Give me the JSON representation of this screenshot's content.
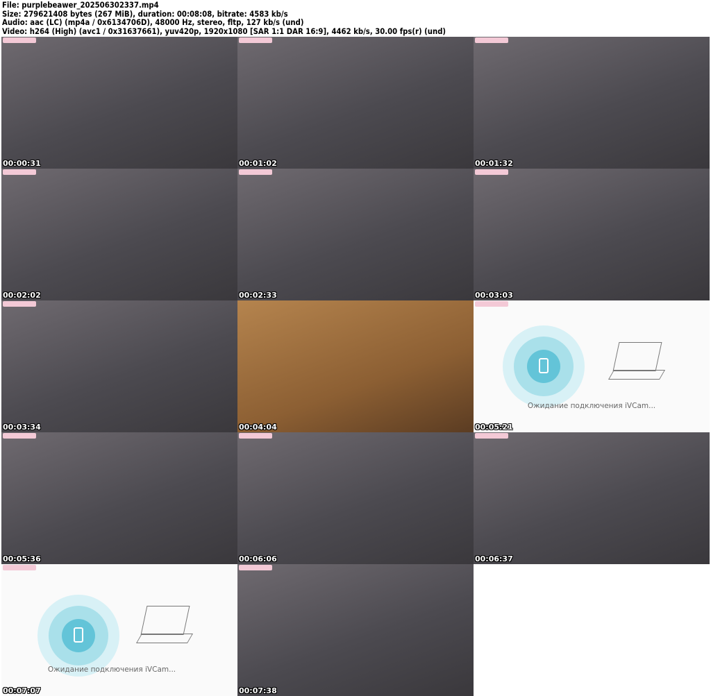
{
  "header": {
    "file": "File: purplebeawer_202506302337.mp4",
    "size": "Size: 279621408 bytes (267 MiB), duration: 00:08:08, bitrate: 4583 kb/s",
    "audio": "Audio: aac (LC) (mp4a / 0x6134706D), 48000 Hz, stereo, fltp, 127 kb/s (und)",
    "video": "Video: h264 (High) (avc1 / 0x31637661), yuv420p, 1920x1080 [SAR 1:1 DAR 16:9], 4462 kb/s, 30.00 fps(r) (und)"
  },
  "ivcam_text": "Ожидание подключения iVCam...",
  "frames": [
    {
      "time": "00:00:31"
    },
    {
      "time": "00:01:02"
    },
    {
      "time": "00:01:32"
    },
    {
      "time": "00:02:02"
    },
    {
      "time": "00:02:33"
    },
    {
      "time": "00:03:03"
    },
    {
      "time": "00:03:34"
    },
    {
      "time": "00:04:04"
    },
    {
      "time": "00:05:21"
    },
    {
      "time": "00:05:36"
    },
    {
      "time": "00:06:06"
    },
    {
      "time": "00:06:37"
    },
    {
      "time": "00:07:07"
    },
    {
      "time": "00:07:38"
    }
  ]
}
